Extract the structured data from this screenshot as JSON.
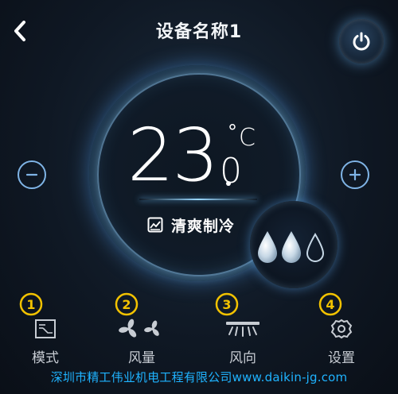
{
  "header": {
    "title": "设备名称1"
  },
  "display": {
    "temperature_int": "23",
    "temperature_frac": "0",
    "degree_symbol": "°",
    "unit": "C",
    "mode_label": "清爽制冷"
  },
  "controls": {
    "minus": "−",
    "plus": "+"
  },
  "badges": [
    "①",
    "②",
    "③",
    "④"
  ],
  "nav": [
    {
      "label": "模式",
      "icon": "mode-icon"
    },
    {
      "label": "风量",
      "icon": "fan-icon"
    },
    {
      "label": "风向",
      "icon": "airflow-direction-icon"
    },
    {
      "label": "设置",
      "icon": "gear-icon"
    }
  ],
  "footer": {
    "text": "深圳市精工伟业机电工程有限公司www.daikin-jg.com"
  },
  "colors": {
    "accent": "#7fb4e6",
    "badge": "#f2c200",
    "footer": "#1fb3ff",
    "background": "#0f1824"
  }
}
